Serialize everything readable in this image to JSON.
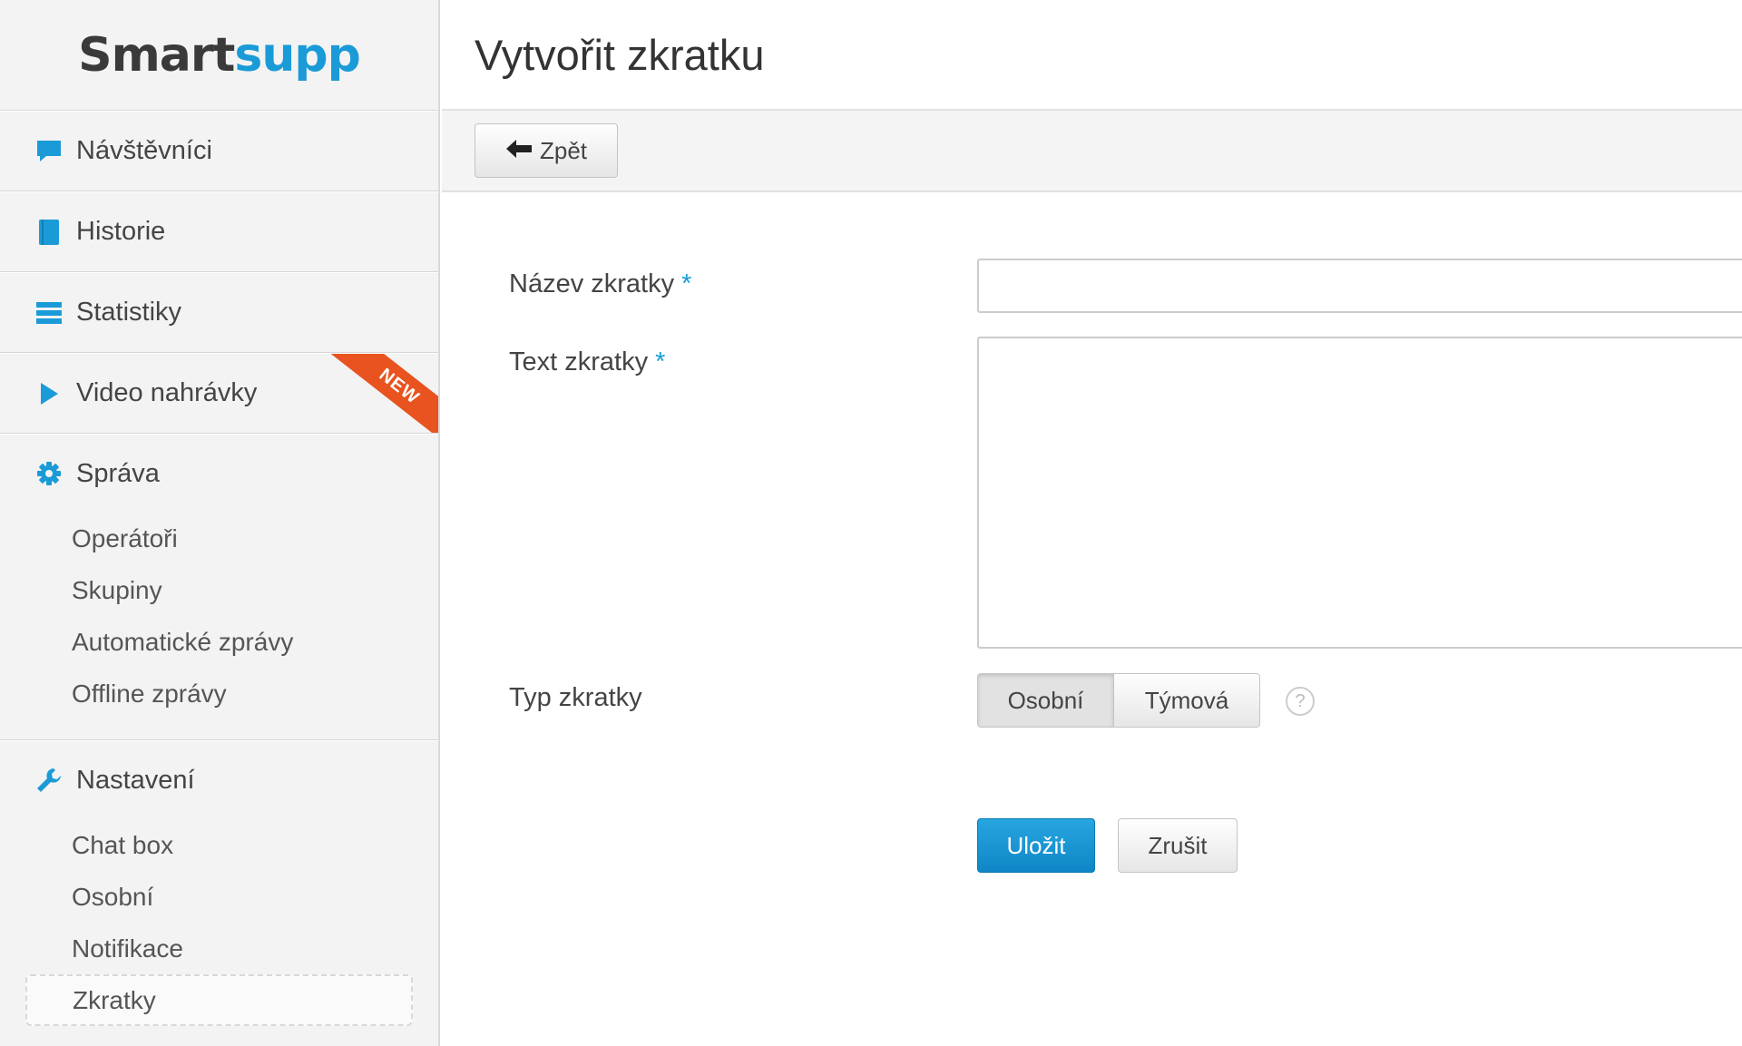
{
  "logo": {
    "part1": "Smart",
    "part2": "supp"
  },
  "sidebar": {
    "items": [
      {
        "label": "Návštěvníci",
        "icon": "chat-bubble-icon"
      },
      {
        "label": "Historie",
        "icon": "book-icon"
      },
      {
        "label": "Statistiky",
        "icon": "list-icon"
      },
      {
        "label": "Video nahrávky",
        "icon": "play-icon",
        "badge": "NEW"
      }
    ],
    "sprava": {
      "label": "Správa",
      "icon": "gear-icon",
      "items": [
        "Operátoři",
        "Skupiny",
        "Automatické zprávy",
        "Offline zprávy"
      ]
    },
    "nastaveni": {
      "label": "Nastavení",
      "icon": "wrench-icon",
      "items": [
        "Chat box",
        "Osobní",
        "Notifikace",
        "Zkratky"
      ],
      "active": "Zkratky"
    }
  },
  "header": {
    "title": "Vytvořit zkratku"
  },
  "toolbar": {
    "back_label": "Zpět"
  },
  "form": {
    "name_label": "Název zkratky",
    "text_label": "Text zkratky",
    "required_mark": "*",
    "type_label": "Typ zkratky",
    "type_options": [
      "Osobní",
      "Týmová"
    ],
    "type_selected": "Osobní",
    "help_glyph": "?",
    "name_value": "",
    "text_value": "",
    "save_label": "Uložit",
    "cancel_label": "Zrušit"
  },
  "colors": {
    "accent": "#1a9bd7",
    "ribbon": "#e8531f"
  }
}
